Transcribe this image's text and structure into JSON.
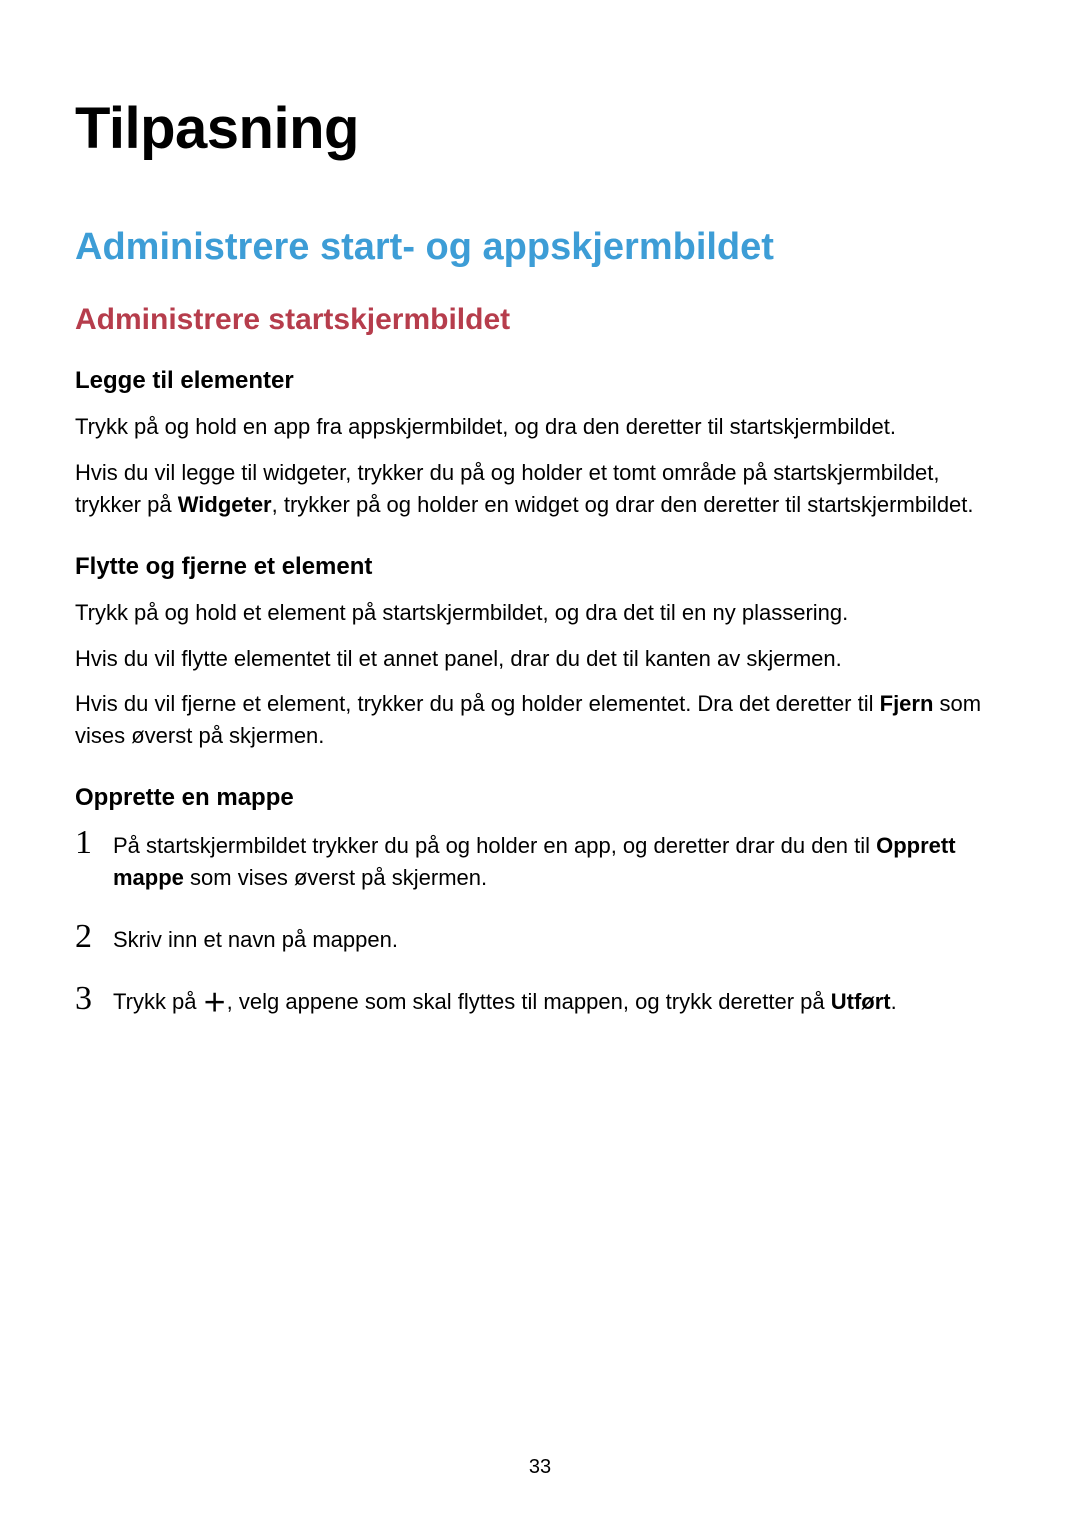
{
  "page": {
    "title": "Tilpasning",
    "section_title": "Administrere start- og appskjermbildet",
    "subsection_title": "Administrere startskjermbildet",
    "page_number": "33"
  },
  "add_elements": {
    "heading": "Legge til elementer",
    "p1": "Trykk på og hold en app fra appskjermbildet, og dra den deretter til startskjermbildet.",
    "p2_a": "Hvis du vil legge til widgeter, trykker du på og holder et tomt område på startskjermbildet, trykker på ",
    "p2_bold": "Widgeter",
    "p2_b": ", trykker på og holder en widget og drar den deretter til startskjermbildet."
  },
  "move_remove": {
    "heading": "Flytte og fjerne et element",
    "p1": "Trykk på og hold et element på startskjermbildet, og dra det til en ny plassering.",
    "p2": "Hvis du vil flytte elementet til et annet panel, drar du det til kanten av skjermen.",
    "p3_a": "Hvis du vil fjerne et element, trykker du på og holder elementet. Dra det deretter til ",
    "p3_bold": "Fjern",
    "p3_b": " som vises øverst på skjermen."
  },
  "create_folder": {
    "heading": "Opprette en mappe",
    "step1_num": "1",
    "step1_a": "På startskjermbildet trykker du på og holder en app, og deretter drar du den til ",
    "step1_bold": "Opprett mappe",
    "step1_b": " som vises øverst på skjermen.",
    "step2_num": "2",
    "step2": "Skriv inn et navn på mappen.",
    "step3_num": "3",
    "step3_a": "Trykk på ",
    "step3_icon": "＋",
    "step3_b": ", velg appene som skal flyttes til mappen, og trykk deretter på ",
    "step3_bold": "Utført",
    "step3_c": "."
  }
}
